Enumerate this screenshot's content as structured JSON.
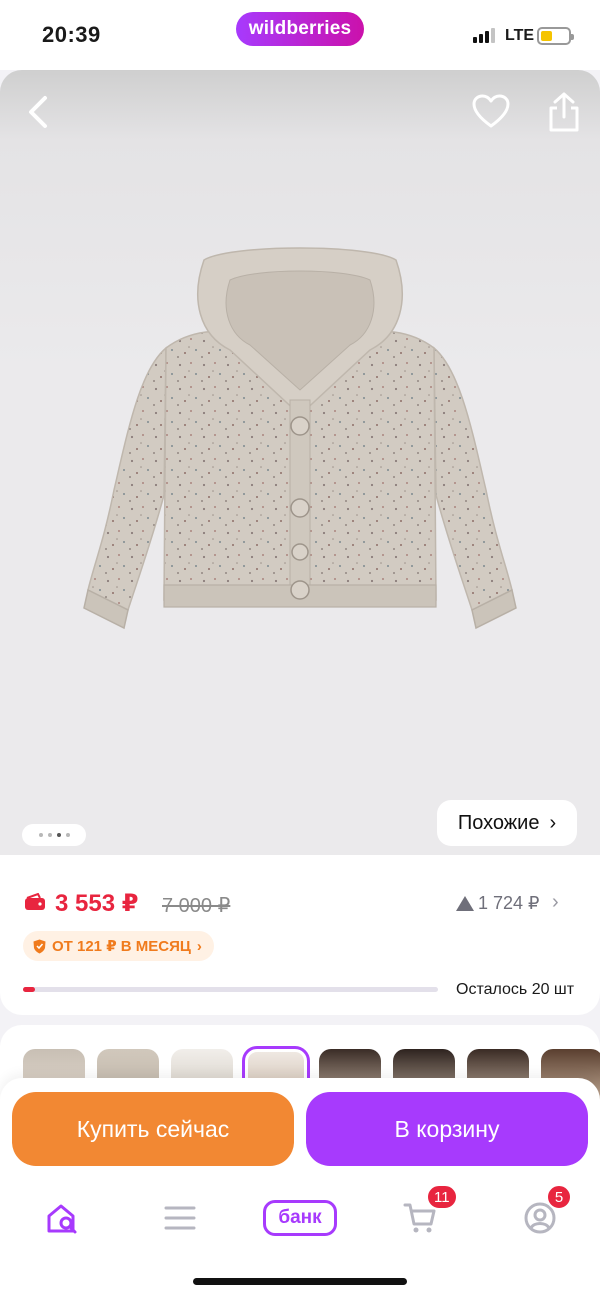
{
  "status_bar": {
    "time": "20:39",
    "brand": "wildberries",
    "network": "LTE"
  },
  "gallery": {
    "back_icon": "chevron-left-icon",
    "favorite_icon": "heart-icon",
    "share_icon": "share-icon",
    "image_count": 4,
    "current_image": 3,
    "similar_label": "Похожие",
    "similar_chevron": "›"
  },
  "price": {
    "current": "3 553 ₽",
    "old": "7 000 ₽",
    "alt_price": "1 724 ₽",
    "alt_chevron": "›",
    "installment": "ОТ 121 ₽ В МЕСЯЦ",
    "installment_chevron": "›",
    "stock_text": "Осталось 20 шт",
    "stock_fill_fraction": 0.03,
    "accent_color": "#e8253f"
  },
  "actions": {
    "buy_now": "Купить сейчас",
    "add_to_cart": "В корзину",
    "buy_color": "#f28833",
    "cart_color": "#a73afd"
  },
  "tabbar": {
    "home_icon": "home-search-icon",
    "catalog_icon": "menu-icon",
    "bank_label": "банк",
    "cart_icon": "cart-icon",
    "cart_badge": "11",
    "profile_icon": "profile-icon",
    "profile_badge": "5"
  }
}
